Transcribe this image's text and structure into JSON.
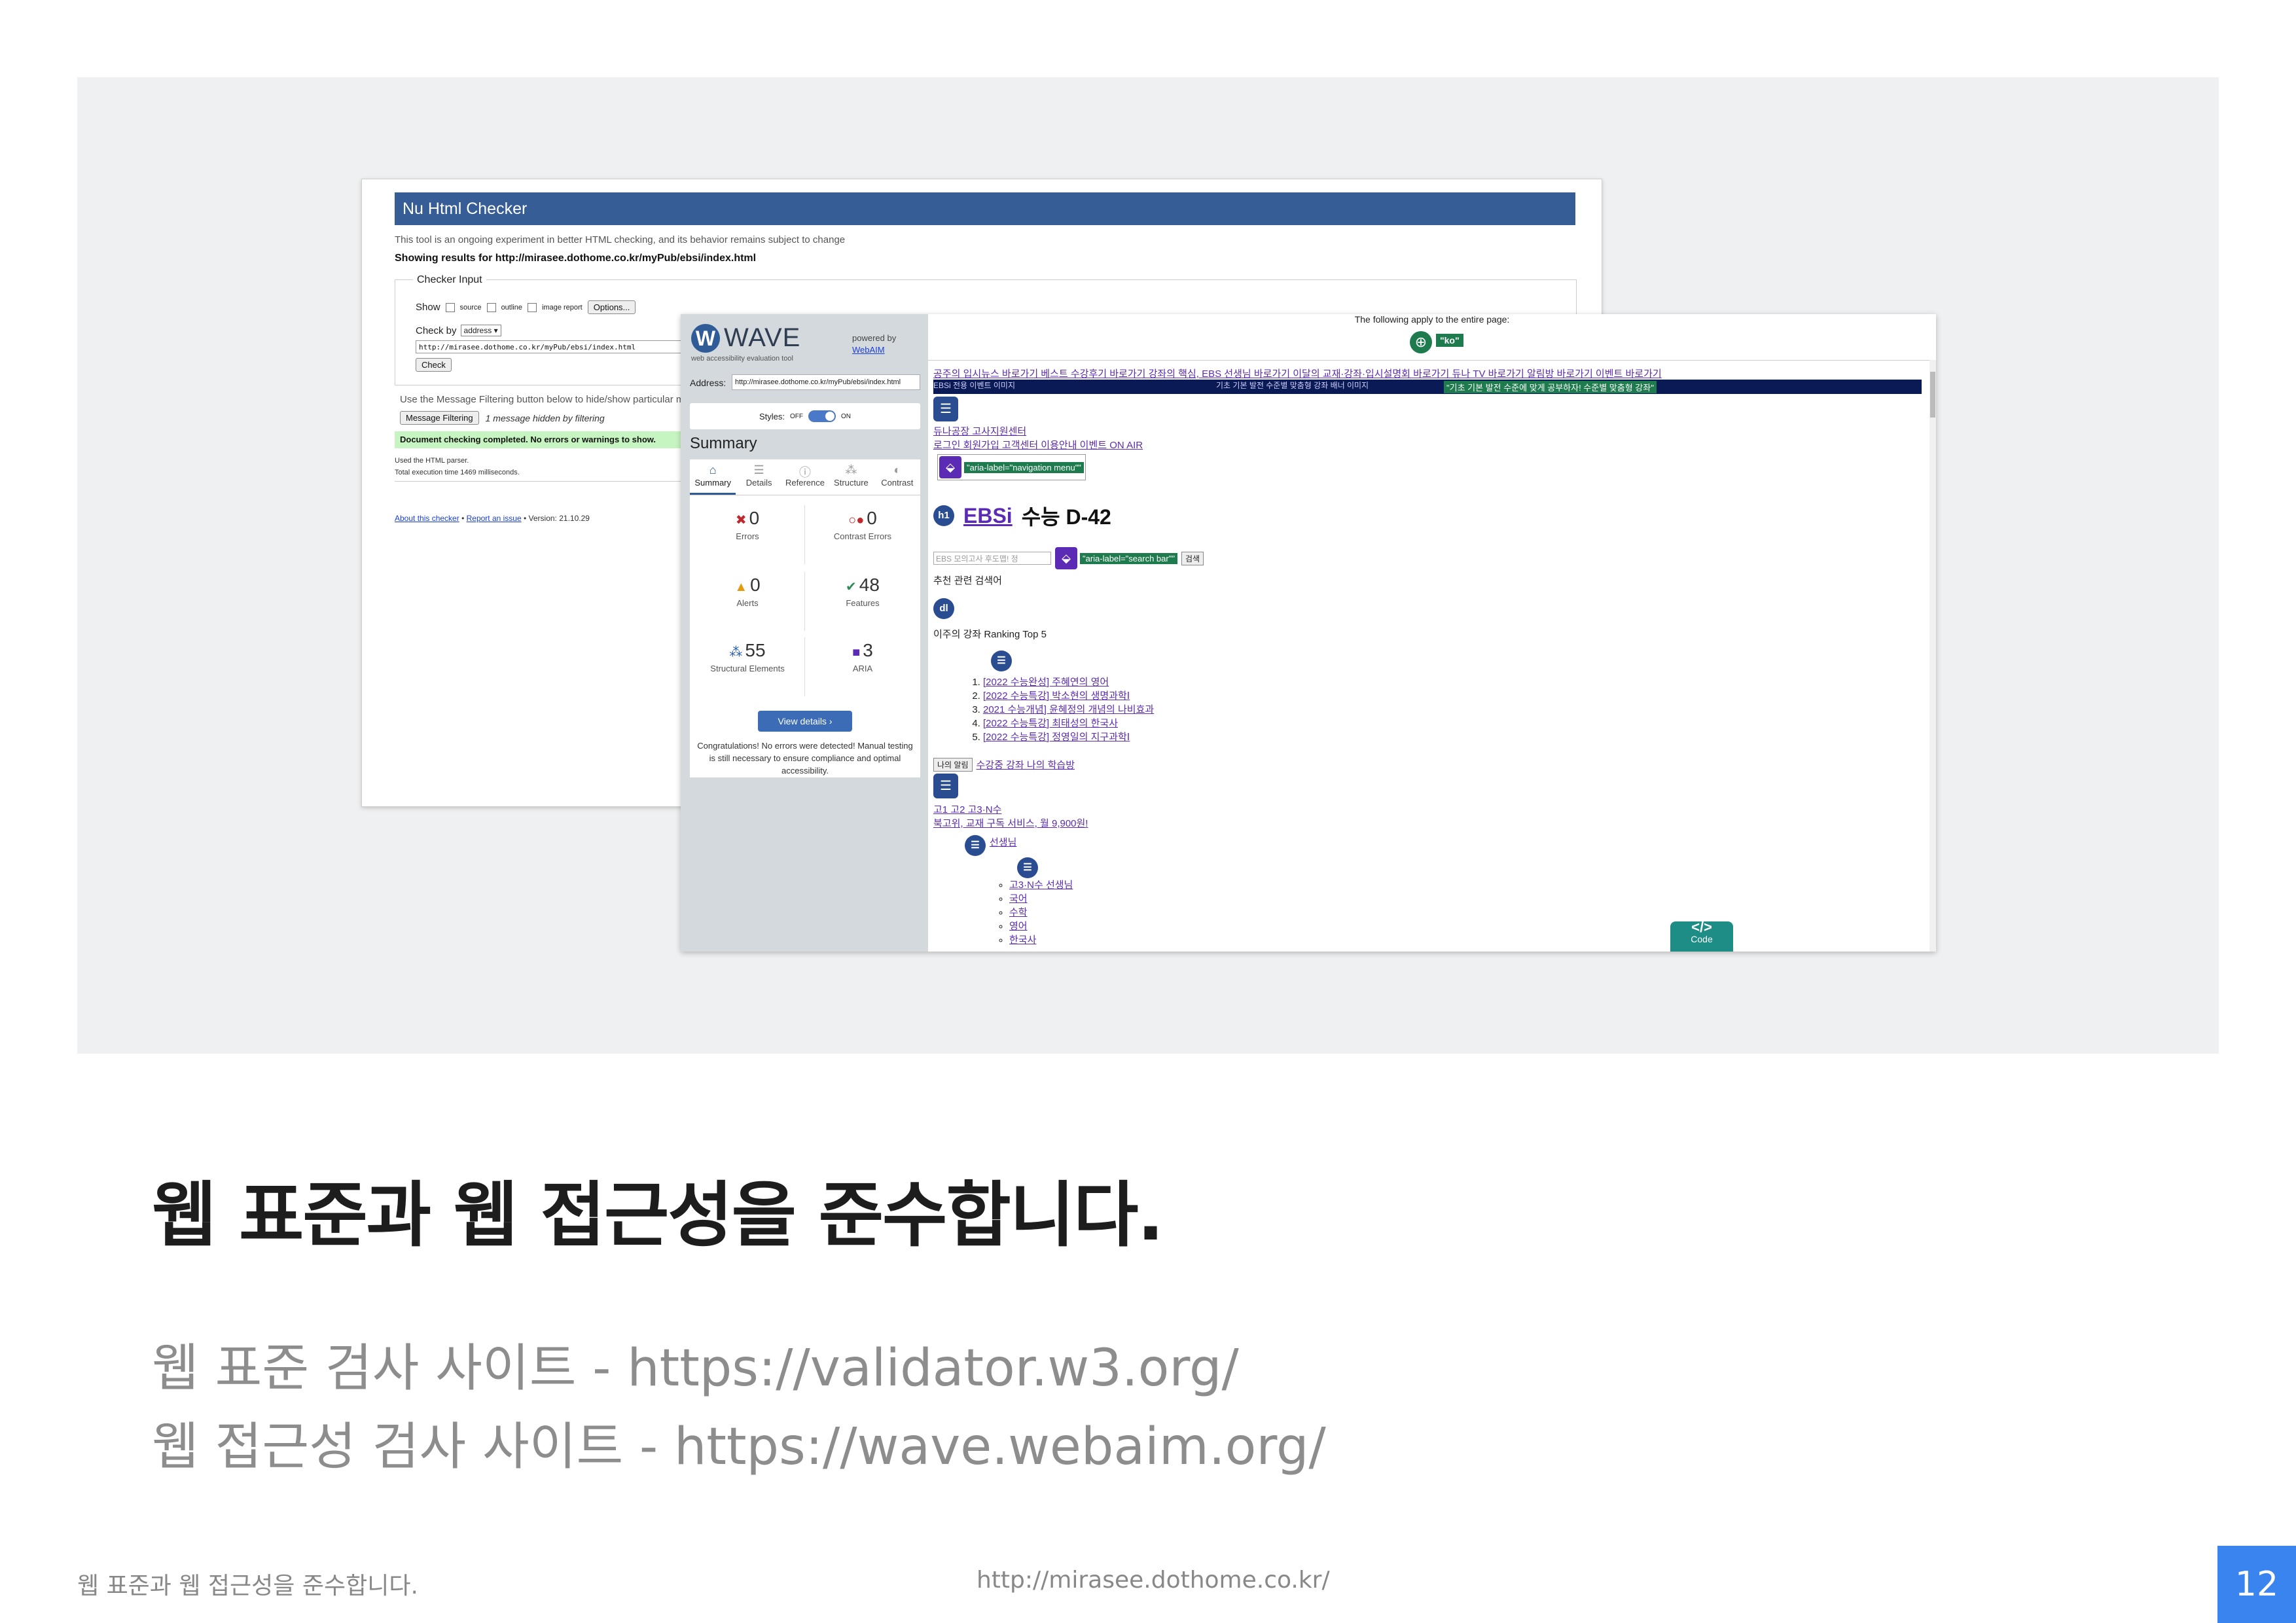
{
  "nu_checker": {
    "title": "Nu Html Checker",
    "intro": "This tool is an ongoing experiment in better HTML checking, and its behavior remains subject to change",
    "showing_results": "Showing results for http://mirasee.dothome.co.kr/myPub/ebsi/index.html",
    "checker_input_legend": "Checker Input",
    "show_label": "Show",
    "show_options": [
      "source",
      "outline",
      "image report"
    ],
    "options_button": "Options...",
    "check_by_label": "Check by",
    "check_by_value": "address",
    "url_value": "http://mirasee.dothome.co.kr/myPub/ebsi/index.html",
    "check_button": "Check",
    "filter_note": "Use the Message Filtering button below to hide/show particular messages, and to see total counts of errors and warnings.",
    "message_filtering_button": "Message Filtering",
    "hidden_note": "1 message hidden by filtering",
    "done_msg": "Document checking completed. No errors or warnings to show.",
    "parser_note": "Used the HTML parser.",
    "time_note": "Total execution time 1469 milliseconds.",
    "footer_about": "About this checker",
    "footer_sep1": "•",
    "footer_report": "Report an issue",
    "footer_version": "• Version: 21.10.29"
  },
  "wave": {
    "logo": "WAVE",
    "tagline": "web accessibility evaluation tool",
    "powered_by": "powered by",
    "webaim": "WebAIM",
    "address_label": "Address:",
    "address_value": "http://mirasee.dothome.co.kr/myPub/ebsi/index.html",
    "styles_label": "Styles:",
    "styles_off": "OFF",
    "styles_on": "ON",
    "summary_heading": "Summary",
    "tabs": [
      {
        "label": "Summary",
        "icon": "home-icon",
        "glyph": "⌂"
      },
      {
        "label": "Details",
        "icon": "list-icon",
        "glyph": "☰"
      },
      {
        "label": "Reference",
        "icon": "info-icon",
        "glyph": "ⓘ"
      },
      {
        "label": "Structure",
        "icon": "structure-icon",
        "glyph": "⁂"
      },
      {
        "label": "Contrast",
        "icon": "contrast-icon",
        "glyph": "◐"
      }
    ],
    "stats": {
      "errors": {
        "value": "0",
        "label": "Errors",
        "color": "#c0282d"
      },
      "contrast_errors": {
        "value": "0",
        "label": "Contrast Errors",
        "color": "#c0282d"
      },
      "alerts": {
        "value": "0",
        "label": "Alerts",
        "color": "#e59a12"
      },
      "features": {
        "value": "48",
        "label": "Features",
        "color": "#2e8b57"
      },
      "structural": {
        "value": "55",
        "label": "Structural Elements",
        "color": "#2a5db0"
      },
      "aria": {
        "value": "3",
        "label": "ARIA",
        "color": "#5b2bb5"
      }
    },
    "view_details": "View details ›",
    "congrats": "Congratulations! No errors were detected! Manual testing is still necessary to ensure compliance and optimal accessibility.",
    "top_note": "The following apply to the entire page:",
    "lang_badge": "\"ko\"",
    "nav_links": "공주의 입시뉴스 바로가기 베스트 수강후기 바로가기 강좌의 핵심, EBS 선생님 바로가기 이달의 교재·강좌·입시설명회 바로가기 듀나 TV 바로가기 알림방 바로가기 이벤트 바로가기",
    "banner_alt": "\"기초 기본 발전 수준에 맞게 공부하자! 수준별 맞춤형 강좌\"",
    "banner_img1": "EBSi 전용 이벤트 이미지",
    "banner_img2": "기초 기본 발전 수준별 맞춤형 강좌 배너 이미지",
    "util_links1": "듀나공장 고사지원센터",
    "util_links2": "로그인 회원가입 고객센터 이용안내 이벤트 ON AIR",
    "aria_nav": "\"aria-label=\"navigation menu\"\"",
    "h1_badge": "h1",
    "ebsi": "EBSi",
    "d_day": "수능 D-42",
    "search_placeholder": "EBS 모의고사 후도맵! 정",
    "aria_search": "\"aria-label=\"search bar\"\"",
    "search_button": "검색",
    "recommend": "추천 관련 검색어",
    "dl_badge": "dl",
    "ranking": "이주의 강좌 Ranking Top 5",
    "ranking_items": [
      "[2022 수능완성] 주혜연의 영어",
      "[2022 수능특강] 박소현의 생명과학Ⅰ",
      "2021 수능개념] 윤혜정의 개념의 나비효과",
      "[2022 수능특강] 최태성의 한국사",
      "[2022 수능특강] 정영일의 지구과학Ⅰ"
    ],
    "my_alarm_button": "나의 알림",
    "my_alarm_link": "수강중 강좌 나의 학습방",
    "grade_links": "고1 고2 고3·N수",
    "sub_service": "북고위, 교재 구독 서비스, 월 9,900원!",
    "teacher": "선생님",
    "teacher_items": [
      "고3·N수 선생님",
      "국어",
      "수학",
      "영어",
      "한국사"
    ],
    "code_glyph": "</>",
    "code_label": "Code"
  },
  "slide": {
    "heading": "웹 표준과 웹 접근성을 준수합니다.",
    "line1": "웹 표준 검사 사이트 -  https://validator.w3.org/",
    "line2": "웹 접근성 검사 사이트 - https://wave.webaim.org/",
    "footer_left": "웹 표준과 웹 접근성을 준수합니다.",
    "footer_center": "http://mirasee.dothome.co.kr/",
    "page_number": "12"
  }
}
